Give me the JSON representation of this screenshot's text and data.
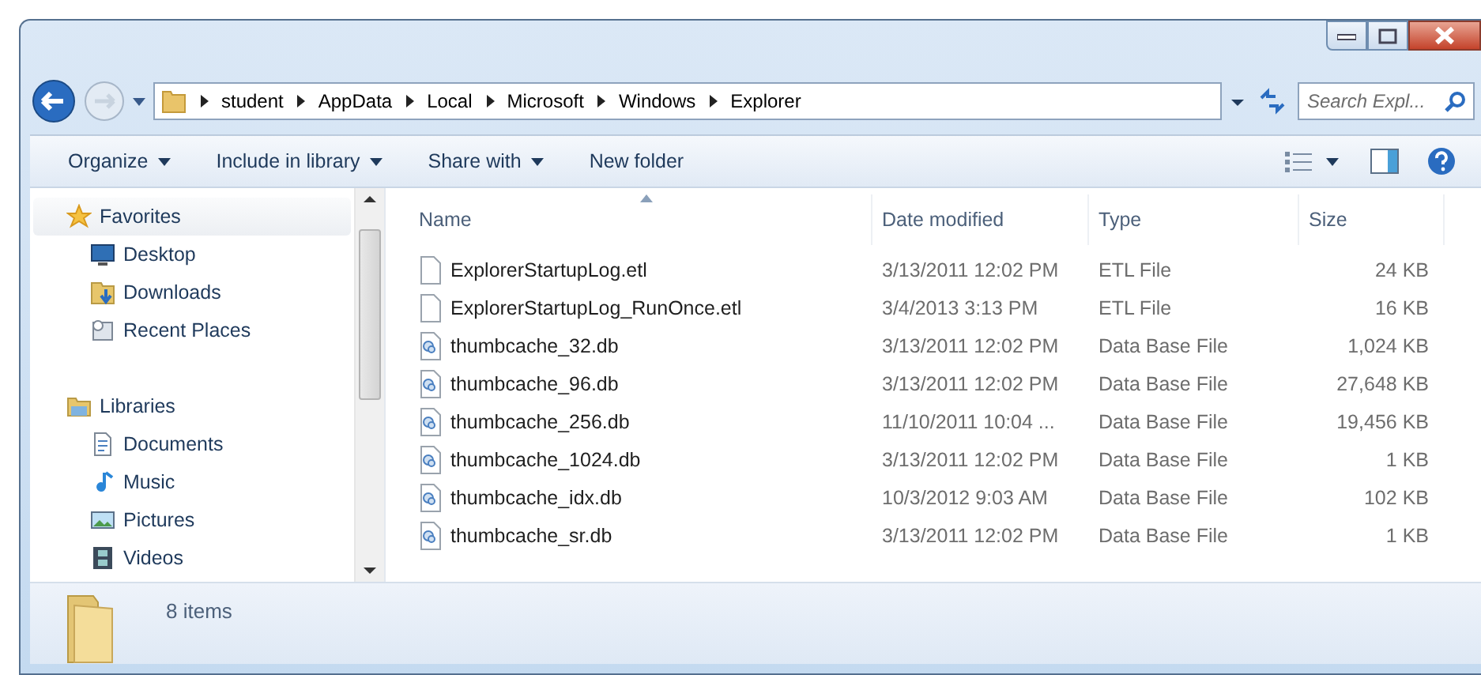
{
  "address": {
    "crumbs": [
      "student",
      "AppData",
      "Local",
      "Microsoft",
      "Windows",
      "Explorer"
    ]
  },
  "search": {
    "placeholder": "Search Expl..."
  },
  "toolbar": [
    {
      "label": "Organize",
      "dropdown": true
    },
    {
      "label": "Include in library",
      "dropdown": true
    },
    {
      "label": "Share with",
      "dropdown": true
    },
    {
      "label": "New folder",
      "dropdown": false
    }
  ],
  "sidebar": {
    "groups": [
      {
        "label": "Favorites",
        "kind": "star",
        "highlighted": true,
        "children": [
          {
            "label": "Desktop",
            "kind": "desktop"
          },
          {
            "label": "Downloads",
            "kind": "downloads"
          },
          {
            "label": "Recent Places",
            "kind": "recent"
          }
        ]
      },
      {
        "label": "Libraries",
        "kind": "library",
        "highlighted": false,
        "children": [
          {
            "label": "Documents",
            "kind": "documents"
          },
          {
            "label": "Music",
            "kind": "music"
          },
          {
            "label": "Pictures",
            "kind": "pictures"
          },
          {
            "label": "Videos",
            "kind": "videos"
          }
        ]
      }
    ]
  },
  "table": {
    "columns": [
      {
        "label": "Name",
        "sorted": true
      },
      {
        "label": "Date modified",
        "sorted": false
      },
      {
        "label": "Type",
        "sorted": false
      },
      {
        "label": "Size",
        "sorted": false
      }
    ],
    "rows": [
      {
        "kind": "blank",
        "name": "ExplorerStartupLog.etl",
        "date": "3/13/2011 12:02 PM",
        "type": "ETL File",
        "size": "24 KB"
      },
      {
        "kind": "blank",
        "name": "ExplorerStartupLog_RunOnce.etl",
        "date": "3/4/2013 3:13 PM",
        "type": "ETL File",
        "size": "16 KB"
      },
      {
        "kind": "db",
        "name": "thumbcache_32.db",
        "date": "3/13/2011 12:02 PM",
        "type": "Data Base File",
        "size": "1,024 KB"
      },
      {
        "kind": "db",
        "name": "thumbcache_96.db",
        "date": "3/13/2011 12:02 PM",
        "type": "Data Base File",
        "size": "27,648 KB"
      },
      {
        "kind": "db",
        "name": "thumbcache_256.db",
        "date": "11/10/2011 10:04 ...",
        "type": "Data Base File",
        "size": "19,456 KB"
      },
      {
        "kind": "db",
        "name": "thumbcache_1024.db",
        "date": "3/13/2011 12:02 PM",
        "type": "Data Base File",
        "size": "1 KB"
      },
      {
        "kind": "db",
        "name": "thumbcache_idx.db",
        "date": "10/3/2012 9:03 AM",
        "type": "Data Base File",
        "size": "102 KB"
      },
      {
        "kind": "db",
        "name": "thumbcache_sr.db",
        "date": "3/13/2011 12:02 PM",
        "type": "Data Base File",
        "size": "1 KB"
      }
    ]
  },
  "status_bar": {
    "text": "8 items"
  }
}
